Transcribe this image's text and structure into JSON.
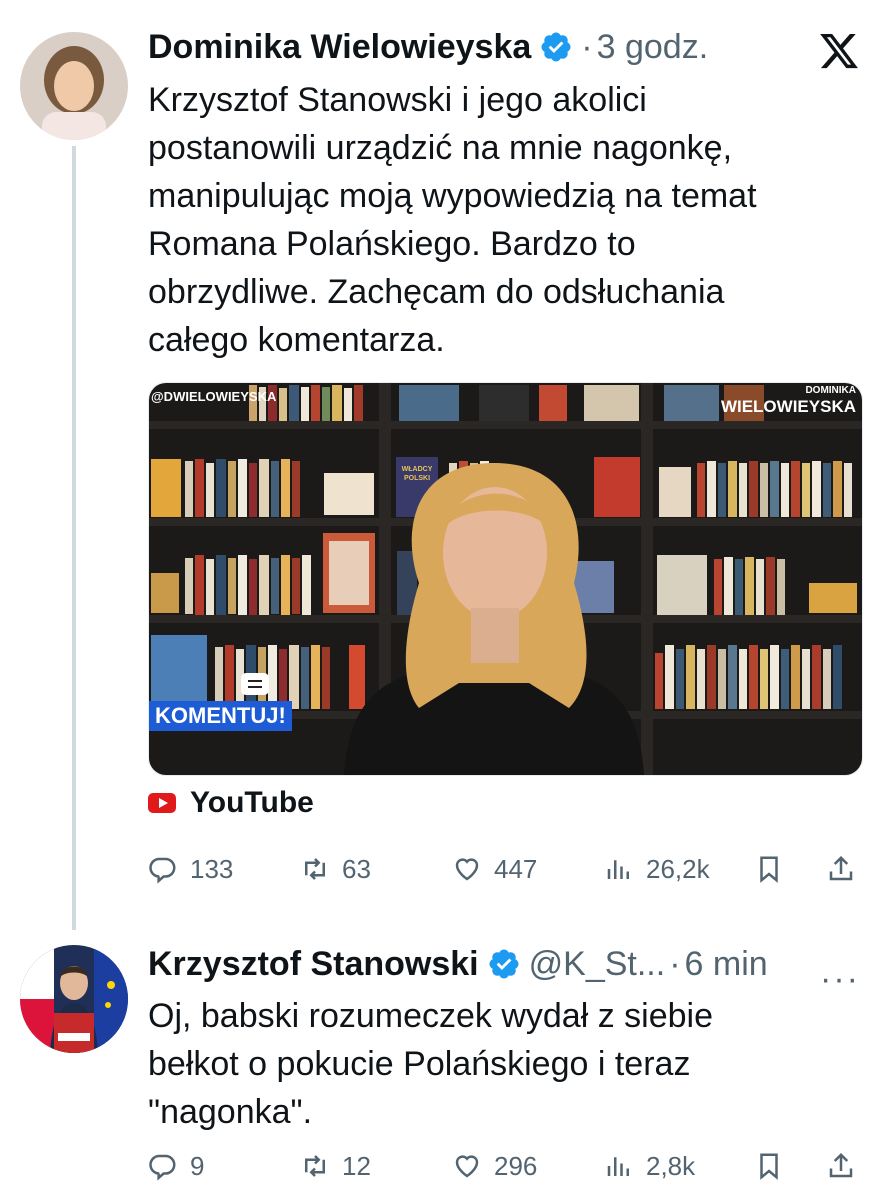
{
  "tweet1": {
    "author_name": "Dominika Wielowieyska",
    "separator": "·",
    "time": "3 godz.",
    "text": "Krzysztof Stanowski i jego akolici\npostanowili urządzić na mnie nagonkę,\nmanipulując moją wypowiedzią na temat\nRomana Polańskiego. Bardzo to\nobrzydliwe. Zachęcam do odsłuchania\ncałego komentarza.",
    "media": {
      "handle_overlay": "@DWIELOWIEYSKA",
      "brand_top": "DOMINIKA",
      "brand_bottom": "WIELOWIEYSKA",
      "comment_label": "KOMENTUJ!",
      "book_title": "WŁADCY POLSKI"
    },
    "source_label": "YouTube",
    "stats": {
      "replies": "133",
      "reposts": "63",
      "likes": "447",
      "views": "26,2k"
    }
  },
  "tweet2": {
    "author_name": "Krzysztof Stanowski",
    "handle": "@K_St...",
    "separator": "·",
    "time": "6 min",
    "text": "Oj, babski rozumeczek wydał z siebie\nbełkot o pokucie Polańskiego i teraz\n\"nagonka\".",
    "stats": {
      "replies": "9",
      "reposts": "12",
      "likes": "296",
      "views": "2,8k"
    }
  },
  "icons": {
    "verified": "verified-badge-icon",
    "x_logo": "x-logo-icon",
    "reply": "reply-icon",
    "repost": "repost-icon",
    "like": "heart-icon",
    "views": "views-icon",
    "bookmark": "bookmark-icon",
    "share": "share-icon",
    "more": "more-icon"
  },
  "colors": {
    "verified": "#1d9bf0",
    "muted": "#536471",
    "text": "#0f1419",
    "youtube": "#e0191b"
  }
}
